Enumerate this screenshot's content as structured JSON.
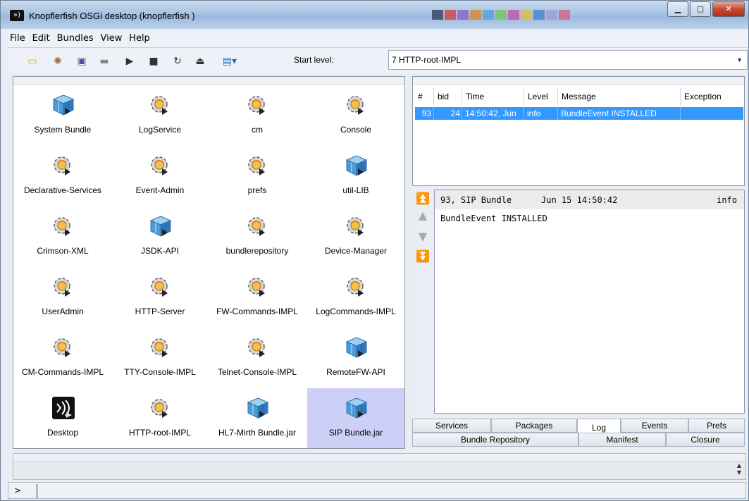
{
  "window": {
    "title": "Knopflerfish OSGi desktop (knopflerfish )",
    "app_icon": "knopflerfish-logo",
    "minimize": "minimize-icon",
    "maximize": "maximize-icon",
    "close": "close-icon"
  },
  "menu": [
    "File",
    "Edit",
    "Bundles",
    "View",
    "Help"
  ],
  "toolbar": {
    "icons": [
      "open-folder-icon",
      "install-gear-icon",
      "save-icon",
      "uninstall-icon",
      "start-icon",
      "stop-icon",
      "refresh-icon",
      "eject-icon",
      "view-menu-icon"
    ],
    "start_level_label": "Start level:",
    "start_level_value": "7 HTTP-root-IMPL"
  },
  "bundles": [
    {
      "name": "System Bundle",
      "icon": "cube-icon",
      "selected": false
    },
    {
      "name": "LogService",
      "icon": "gear-bundle-icon",
      "selected": false
    },
    {
      "name": "cm",
      "icon": "gear-bundle-icon",
      "selected": false
    },
    {
      "name": "Console",
      "icon": "gear-bundle-icon",
      "selected": false
    },
    {
      "name": "Declarative-Services",
      "icon": "gear-bundle-icon",
      "selected": false
    },
    {
      "name": "Event-Admin",
      "icon": "gear-bundle-icon",
      "selected": false
    },
    {
      "name": "prefs",
      "icon": "gear-bundle-icon",
      "selected": false
    },
    {
      "name": "util-LIB",
      "icon": "cube-icon",
      "selected": false
    },
    {
      "name": "Crimson-XML",
      "icon": "gear-bundle-icon",
      "selected": false
    },
    {
      "name": "JSDK-API",
      "icon": "cube-icon",
      "selected": false
    },
    {
      "name": "bundlerepository",
      "icon": "gear-bundle-icon",
      "selected": false
    },
    {
      "name": "Device-Manager",
      "icon": "gear-bundle-icon",
      "selected": false
    },
    {
      "name": "UserAdmin",
      "icon": "gear-bundle-icon",
      "selected": false
    },
    {
      "name": "HTTP-Server",
      "icon": "gear-bundle-icon",
      "selected": false
    },
    {
      "name": "FW-Commands-IMPL",
      "icon": "gear-bundle-icon",
      "selected": false
    },
    {
      "name": "LogCommands-IMPL",
      "icon": "gear-bundle-icon",
      "selected": false
    },
    {
      "name": "CM-Commands-IMPL",
      "icon": "gear-bundle-icon",
      "selected": false
    },
    {
      "name": "TTY-Console-IMPL",
      "icon": "gear-bundle-icon",
      "selected": false
    },
    {
      "name": "Telnet-Console-IMPL",
      "icon": "gear-bundle-icon",
      "selected": false
    },
    {
      "name": "RemoteFW-API",
      "icon": "cube-icon",
      "selected": false
    },
    {
      "name": "Desktop",
      "icon": "knopflerfish-logo-icon",
      "selected": false
    },
    {
      "name": "HTTP-root-IMPL",
      "icon": "gear-bundle-icon",
      "selected": false
    },
    {
      "name": "HL7-Mirth Bundle.jar",
      "icon": "cube-icon",
      "selected": false
    },
    {
      "name": "SIP Bundle.jar",
      "icon": "cube-icon",
      "selected": true
    }
  ],
  "log": {
    "columns": [
      "#",
      "bid",
      "Time",
      "Level",
      "Message",
      "Exception"
    ],
    "rows": [
      {
        "num": "93",
        "bid": "24",
        "time": "14:50:42, Jun",
        "level": "info",
        "message": "BundleEvent INSTALLED",
        "exception": ""
      }
    ]
  },
  "detail": {
    "header_left": "93, SIP Bundle",
    "header_time": "Jun 15 14:50:42",
    "header_level": "info",
    "body": "BundleEvent INSTALLED",
    "nav_icons": [
      "first-icon",
      "prev-icon",
      "next-icon",
      "last-icon"
    ]
  },
  "tabs": {
    "row1": [
      "Services",
      "Packages",
      "Log",
      "Events",
      "Prefs"
    ],
    "row2": [
      "Bundle Repository",
      "Manifest",
      "Closure"
    ],
    "active": "Log"
  },
  "console": {
    "prompt": ">",
    "value": ""
  }
}
